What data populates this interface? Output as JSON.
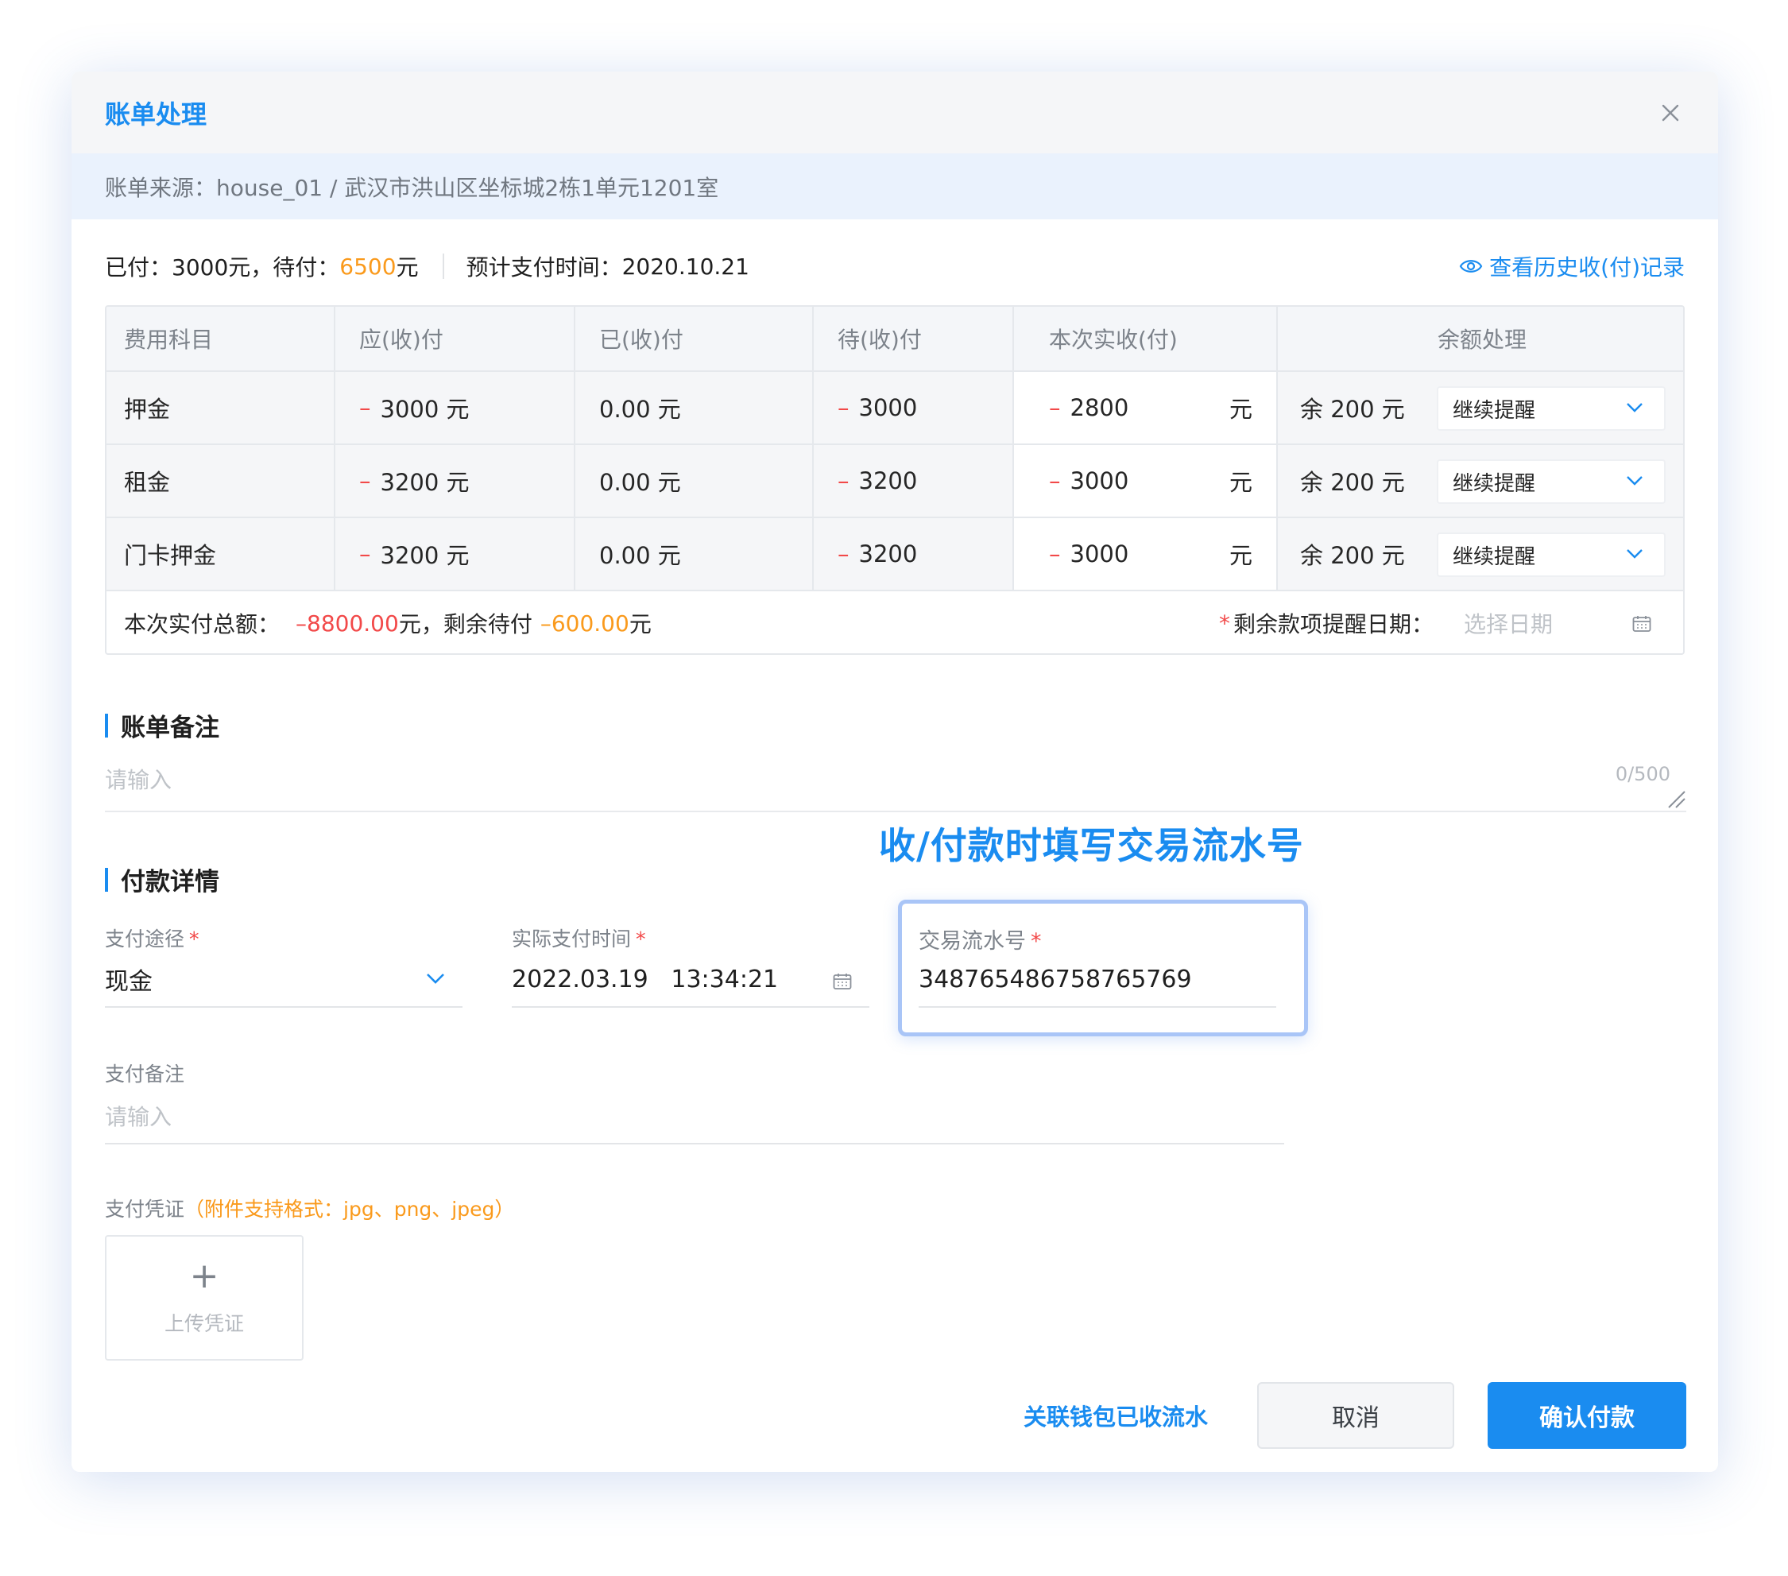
{
  "modal": {
    "title": "账单处理",
    "source_label": "账单来源：",
    "source_value": "house_01 / 武汉市洪山区坐标城2栋1单元1201室"
  },
  "summary": {
    "paid_label": "已付：",
    "paid_value": "3000元，",
    "pending_label": "待付：",
    "pending_amount": "6500",
    "pending_unit": "元",
    "expected_label": "预计支付时间：",
    "expected_date": "2020.10.21",
    "history_link": "查看历史收(付)记录"
  },
  "table": {
    "headers": [
      "费用科目",
      "应(收)付",
      "已(收)付",
      "待(收)付",
      "本次实收(付)",
      "余额处理"
    ],
    "rows": [
      {
        "item": "押金",
        "due": "3000 元",
        "paid": "0.00 元",
        "pending": "3000",
        "actual": "2800",
        "unit": "元",
        "balance": "余 200 元",
        "action": "继续提醒"
      },
      {
        "item": "租金",
        "due": "3200 元",
        "paid": "0.00 元",
        "pending": "3200",
        "actual": "3000",
        "unit": "元",
        "balance": "余 200 元",
        "action": "继续提醒"
      },
      {
        "item": "门卡押金",
        "due": "3200 元",
        "paid": "0.00 元",
        "pending": "3200",
        "actual": "3000",
        "unit": "元",
        "balance": "余 200 元",
        "action": "继续提醒"
      }
    ],
    "minus_sign": "–",
    "total_label": "本次实付总额：",
    "total_value": "–8800.00",
    "total_unit": "元，剩余待付",
    "remaining_value": "–600.00",
    "remaining_unit": "元",
    "remind_star": "*",
    "remind_label": "剩余款项提醒日期：",
    "remind_placeholder": "选择日期"
  },
  "remark": {
    "title": "账单备注",
    "placeholder": "请输入",
    "counter": "0/500"
  },
  "annotation": "收/付款时填写交易流水号",
  "payment": {
    "title": "付款详情",
    "method_label": "支付途径",
    "method_value": "现金",
    "time_label": "实际支付时间",
    "time_value": "2022.03.19   13:34:21",
    "serial_label": "交易流水号",
    "serial_value": "348765486758765769",
    "star": "*",
    "note_label": "支付备注",
    "note_placeholder": "请输入",
    "voucher_label": "支付凭证",
    "voucher_hint": "（附件支持格式：jpg、png、jpeg）",
    "upload_label": "上传凭证",
    "upload_plus": "+"
  },
  "footer": {
    "link_button": "关联钱包已收流水",
    "cancel_button": "取消",
    "confirm_button": "确认付款"
  },
  "colors": {
    "primary": "#1a8cf0",
    "danger": "#f24949",
    "warning": "#fa9a1c"
  }
}
